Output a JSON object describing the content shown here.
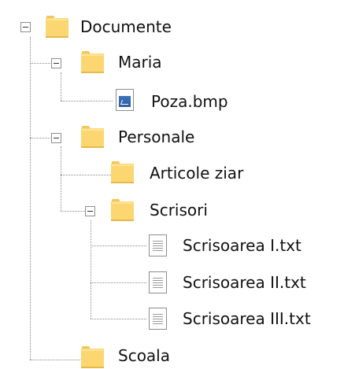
{
  "tree": {
    "root": {
      "label": "Documente",
      "children": [
        {
          "label": "Maria",
          "children": [
            {
              "label": "Poza.bmp",
              "icon": "bitmap-file-icon"
            }
          ]
        },
        {
          "label": "Personale",
          "children": [
            {
              "label": "Articole ziar",
              "icon": "folder-icon"
            },
            {
              "label": "Scrisori",
              "children": [
                {
                  "label": "Scrisoarea I.txt",
                  "icon": "text-file-icon"
                },
                {
                  "label": "Scrisoarea II.txt",
                  "icon": "text-file-icon"
                },
                {
                  "label": "Scrisoarea III.txt",
                  "icon": "text-file-icon"
                }
              ]
            }
          ]
        },
        {
          "label": "Scoala",
          "icon": "folder-icon"
        }
      ]
    }
  },
  "colors": {
    "folder": "#fcd771",
    "folder_tab": "#f2c65c",
    "bitmap": "#2a5ea6",
    "connector": "#8a8a8a"
  }
}
